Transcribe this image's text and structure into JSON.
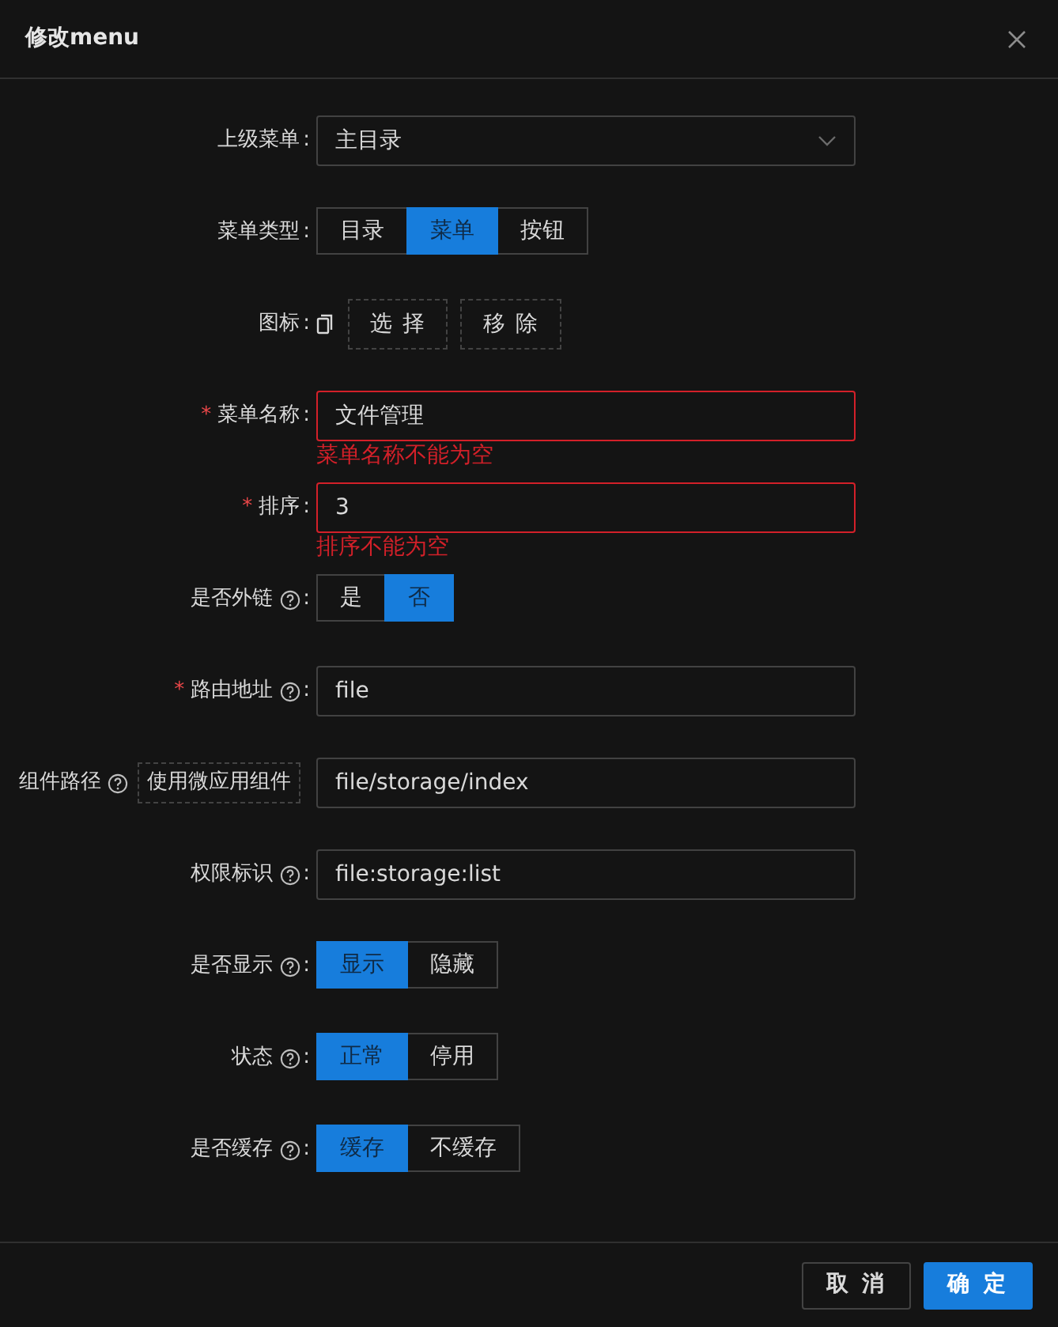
{
  "dialog": {
    "title": "修改menu"
  },
  "required_mark": "*",
  "fields": [
    {
      "kind": "select",
      "label": "上级菜单",
      "colon": ":",
      "required": false,
      "help": false,
      "value": "主目录"
    },
    {
      "kind": "segmented",
      "label": "菜单类型",
      "colon": ":",
      "required": false,
      "help": false,
      "options": [
        {
          "label": "目录",
          "selected": false
        },
        {
          "label": "菜单",
          "selected": true
        },
        {
          "label": "按钮",
          "selected": false
        }
      ]
    },
    {
      "kind": "icon",
      "label": "图标",
      "colon": ":",
      "required": false,
      "help": false,
      "buttons": [
        "选 择",
        "移 除"
      ]
    },
    {
      "kind": "input",
      "label": "菜单名称",
      "colon": ":",
      "required": true,
      "help": false,
      "value": "文件管理",
      "error": "菜单名称不能为空"
    },
    {
      "kind": "input",
      "label": "排序",
      "colon": ":",
      "required": true,
      "help": false,
      "value": "3",
      "error": "排序不能为空"
    },
    {
      "kind": "segmented",
      "label": "是否外链",
      "colon": ":",
      "required": false,
      "help": true,
      "options": [
        {
          "label": "是",
          "selected": false
        },
        {
          "label": "否",
          "selected": true
        }
      ]
    },
    {
      "kind": "input",
      "label": "路由地址",
      "colon": ":",
      "required": true,
      "help": true,
      "value": "file"
    },
    {
      "kind": "input",
      "label": "组件路径",
      "required": false,
      "help": true,
      "extra_button": "使用微应用组件",
      "value": "file/storage/index"
    },
    {
      "kind": "input",
      "label": "权限标识",
      "colon": ":",
      "required": false,
      "help": true,
      "value": "file:storage:list"
    },
    {
      "kind": "segmented",
      "label": "是否显示",
      "colon": ":",
      "required": false,
      "help": true,
      "options": [
        {
          "label": "显示",
          "selected": true
        },
        {
          "label": "隐藏",
          "selected": false
        }
      ]
    },
    {
      "kind": "segmented",
      "label": "状态",
      "colon": ":",
      "required": false,
      "help": true,
      "options": [
        {
          "label": "正常",
          "selected": true
        },
        {
          "label": "停用",
          "selected": false
        }
      ]
    },
    {
      "kind": "segmented",
      "label": "是否缓存",
      "colon": ":",
      "required": false,
      "help": true,
      "options": [
        {
          "label": "缓存",
          "selected": true
        },
        {
          "label": "不缓存",
          "selected": false
        }
      ]
    }
  ],
  "footer": {
    "buttons": [
      {
        "label": "取 消",
        "primary": false
      },
      {
        "label": "确 定",
        "primary": true
      }
    ]
  }
}
